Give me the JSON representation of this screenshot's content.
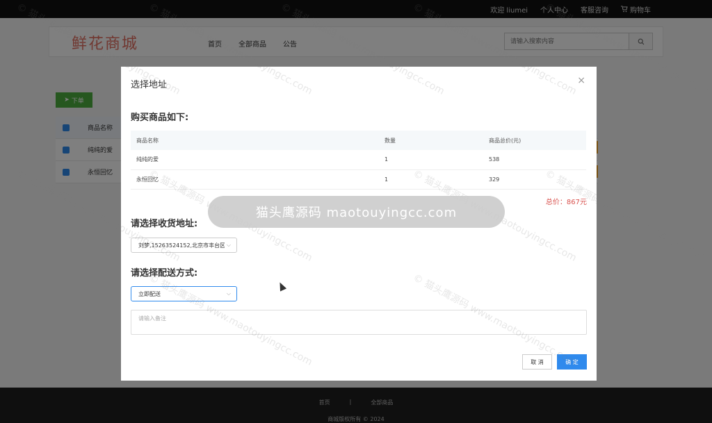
{
  "topbar": {
    "welcome": "欢迎 liumei",
    "personal_center": "个人中心",
    "service": "客服咨询",
    "cart": "购物车"
  },
  "header": {
    "logo": "鲜花商城",
    "nav": [
      "首页",
      "全部商品",
      "公告"
    ],
    "search_placeholder": "请输入搜索内容"
  },
  "background": {
    "order_button": "下单",
    "table_header": "商品名称",
    "rows": [
      "纯纯的爱",
      "永恒回忆"
    ]
  },
  "footer": {
    "links": [
      "首页",
      "|",
      "全部商品"
    ],
    "copyright": "商城版权所有 © 2024"
  },
  "modal": {
    "title": "选择地址",
    "close": "×",
    "goods_heading": "购买商品如下:",
    "table": {
      "headers": [
        "商品名称",
        "数量",
        "商品总价(元)"
      ],
      "rows": [
        [
          "纯纯的爱",
          "1",
          "538"
        ],
        [
          "永恒回忆",
          "1",
          "329"
        ]
      ]
    },
    "total": "总价：867元",
    "address_heading": "请选择收货地址:",
    "address_value": "刘梦,15263524152,北京市丰台区",
    "delivery_heading": "请选择配送方式:",
    "delivery_value": "立即配送",
    "remark_placeholder": "请输入备注",
    "cancel": "取 消",
    "confirm": "确 定"
  },
  "watermark": {
    "banner": "猫头鹰源码 maotouyingcc.com",
    "repeat": "© 猫头鹰源码 www.maotouyingcc.com"
  }
}
